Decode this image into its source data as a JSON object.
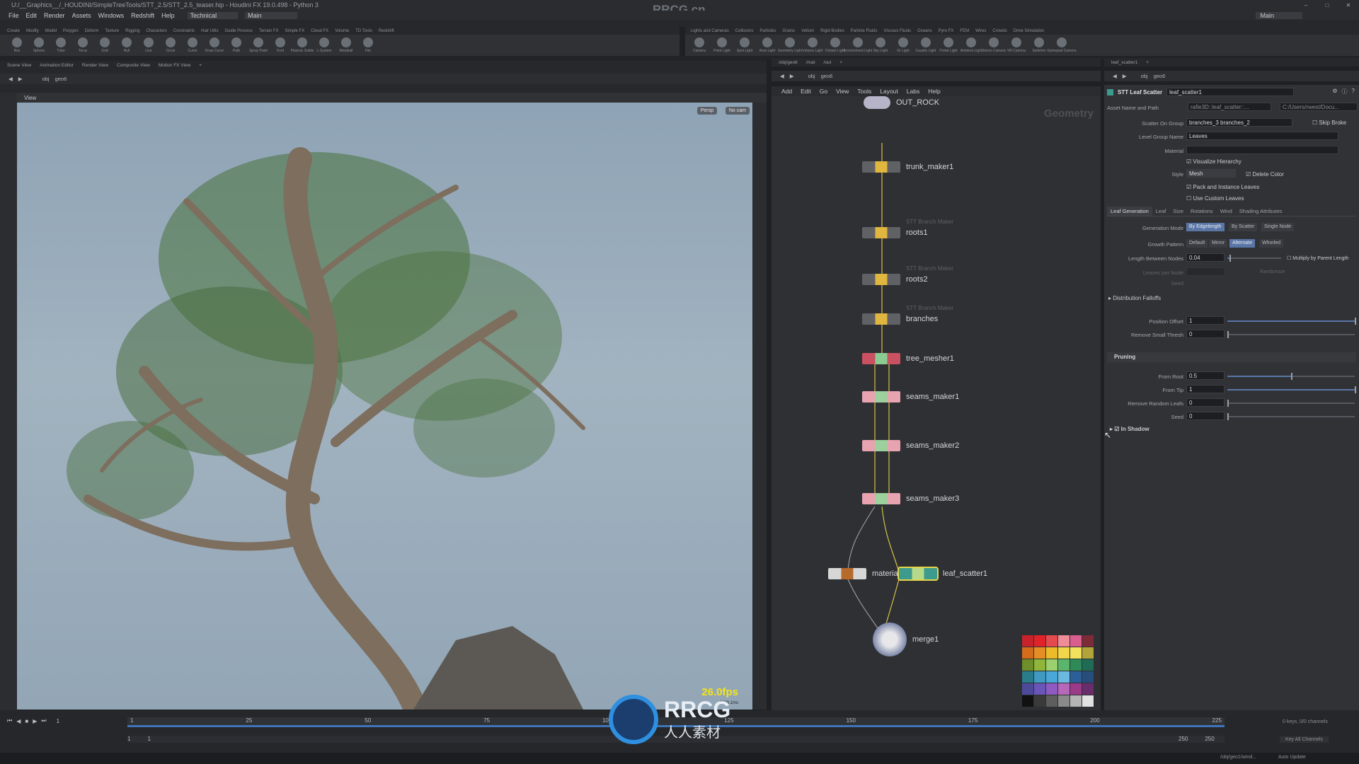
{
  "window": {
    "title": "U:/__Graphics__/_HOUDINI/SimpleTreeTools/STT_2.5/STT_2.5_teaser.hip - Houdini FX 19.0.498 - Python 3",
    "watermark": "RRCG.cn",
    "desktop": "Main"
  },
  "menu": [
    "File",
    "Edit",
    "Render",
    "Assets",
    "Windows",
    "Redshift",
    "Help"
  ],
  "desktop_select": "Technical",
  "main_label": "Main",
  "shelf_left": {
    "tabs": [
      "Create",
      "Modify",
      "Model",
      "Polygon",
      "Deform",
      "Texture",
      "Rigging",
      "Characters",
      "Constraints",
      "Hair Utils",
      "Guide Process",
      "Terrain FX",
      "Simple FX",
      "Cloud FX",
      "Volume",
      "TD Tools",
      "Redshift"
    ],
    "tools": [
      "Box",
      "Sphere",
      "Tube",
      "Torus",
      "Grid",
      "Null",
      "Line",
      "Circle",
      "Curve",
      "Draw Curve",
      "Path",
      "Spray Paint",
      "Font",
      "Platonic Solids",
      "L-System",
      "Metaball",
      "File"
    ]
  },
  "shelf_right": {
    "tabs": [
      "Lights and Cameras",
      "Collisions",
      "Particles",
      "Grains",
      "Vellum",
      "Rigid Bodies",
      "Particle Fluids",
      "Viscous Fluids",
      "Oceans",
      "Pyro FX",
      "FEM",
      "Wires",
      "Crowds",
      "Drive Simulation"
    ],
    "tools": [
      "Camera",
      "Point Light",
      "Spot Light",
      "Area Light",
      "Geometry Light",
      "Volume Light",
      "Distant Light",
      "Environment Light",
      "Sky Light",
      "GI Light",
      "Caustic Light",
      "Portal Light",
      "Ambient Light",
      "Stereo Camera",
      "VR Camera",
      "Switcher",
      "Gamepad Camera"
    ]
  },
  "viewport": {
    "tabs": [
      "Scene View",
      "Animation Editor",
      "Render View",
      "Composite View",
      "Motion FX View"
    ],
    "path": [
      "obj",
      "geo6"
    ],
    "header": "View",
    "persp": "Persp",
    "cam": "No cam",
    "fps": "26.0fps",
    "fps_sub": "2303.1ms"
  },
  "network": {
    "tabs": [
      "/obj/geo6",
      "/mat",
      "/out"
    ],
    "path": [
      "obj",
      "geo6"
    ],
    "menu": [
      "Add",
      "Edit",
      "Go",
      "View",
      "Tools",
      "Layout",
      "Labs",
      "Help"
    ],
    "context_title": "Geometry",
    "nodes": [
      {
        "name": "OUT_ROCK",
        "sub": ""
      },
      {
        "name": "trunk_maker1",
        "sub": ""
      },
      {
        "name": "roots1",
        "sub": "STT Branch Maker"
      },
      {
        "name": "roots2",
        "sub": "STT Branch Maker"
      },
      {
        "name": "branches",
        "sub": "STT Branch Maker"
      },
      {
        "name": "tree_mesher1",
        "sub": ""
      },
      {
        "name": "seams_maker1",
        "sub": ""
      },
      {
        "name": "seams_maker2",
        "sub": ""
      },
      {
        "name": "seams_maker3",
        "sub": ""
      },
      {
        "name": "material1",
        "sub": ""
      },
      {
        "name": "leaf_scatter1",
        "sub": ""
      },
      {
        "name": "merge1",
        "sub": ""
      }
    ],
    "palette": [
      "#c8222b",
      "#e0232a",
      "#e54a4f",
      "#ef8c96",
      "#d95f8e",
      "#7e2b39",
      "#d36d1c",
      "#e58e24",
      "#ecbb2a",
      "#f0d64a",
      "#f2e25d",
      "#b0a43a",
      "#6f8f2a",
      "#8fb63a",
      "#9bd06c",
      "#5ab56d",
      "#2e8a57",
      "#1f6b55",
      "#2a7b8b",
      "#3f99c0",
      "#4aa8d8",
      "#6bb9e0",
      "#2c5f97",
      "#274d7c",
      "#4e4a9a",
      "#6a55b8",
      "#8f5bc2",
      "#b768b9",
      "#9a3a88",
      "#6a2d6b",
      "#111111",
      "#3a3a3a",
      "#5e5e5e",
      "#8a8a8a",
      "#b5b5b5",
      "#e2e2e2"
    ]
  },
  "params": {
    "tabs": [
      "leaf_scatter1"
    ],
    "path": [
      "obj",
      "geo6"
    ],
    "node_type": "STT Leaf Scatter",
    "node_name": "leaf_scatter1",
    "asset_label": "Asset Name and Path",
    "asset_value": "rafie3D::leaf_scatter::...",
    "asset_path": "C:/Users/rwest/Docu...",
    "scatter_group_label": "Scatter On Group",
    "scatter_group": "branches_3 branches_2",
    "skip_broken": "Skip Broke",
    "level_group_label": "Level Group Name",
    "level_group": "Leaves",
    "material_label": "Material",
    "material": "",
    "visualize": "Visualize Hierarchy",
    "style_label": "Style",
    "style": "Mesh",
    "delete_color": "Delete Color",
    "pack": "Pack and Instance Leaves",
    "custom": "Use Custom Leaves",
    "sections": [
      "Leaf Generation",
      "Leaf",
      "Size",
      "Rotations",
      "Wind",
      "Shading Attributes"
    ],
    "gen_mode_label": "Generation Mode",
    "gen_modes": [
      "By Edgelength",
      "By Scatter",
      "Single Node"
    ],
    "growth_label": "Growth Pattern",
    "growth": [
      "Default",
      "Mirror",
      "Alternate",
      "Whorled"
    ],
    "length_label": "Length Between Nodes",
    "length": "0.04",
    "length_frac": 0.04,
    "multiply": "Multiply by Parent Length",
    "leaves_per_node": "Leaves per Node",
    "randomize": "Randomize",
    "seed_label": "Seed",
    "dist_falloffs": "Distribution Falloffs",
    "pos_offset_label": "Position Offset",
    "pos_offset": "1",
    "pos_offset_frac": 1,
    "remove_small_label": "Remove Small Thresh",
    "remove_small": "0",
    "remove_small_frac": 0,
    "pruning": "Pruning",
    "from_root_label": "From Root",
    "from_root": "0.5",
    "from_root_frac": 0.5,
    "from_tip_label": "From Tip",
    "from_tip": "1",
    "from_tip_frac": 1,
    "remove_random_label": "Remove Random Leafs",
    "remove_random": "0",
    "remove_random_frac": 0,
    "seed2_label": "Seed",
    "seed2": "0",
    "seed2_frac": 0,
    "in_shadow": "In Shadow"
  },
  "timeline": {
    "frame": "1",
    "start": "1",
    "start2": "1",
    "end": "250",
    "end2": "250",
    "ticks": [
      "1",
      "25",
      "50",
      "75",
      "100",
      "125",
      "150",
      "175",
      "200",
      "225"
    ],
    "keys": "0 keys, 0/0 channels",
    "key_all": "Key All Channels",
    "auto_update": "Auto Update",
    "status_path": "/obj/geo1/wind..."
  },
  "overlay": {
    "rrcg": "RRCG",
    "rrcg_sub": "人人素材"
  }
}
